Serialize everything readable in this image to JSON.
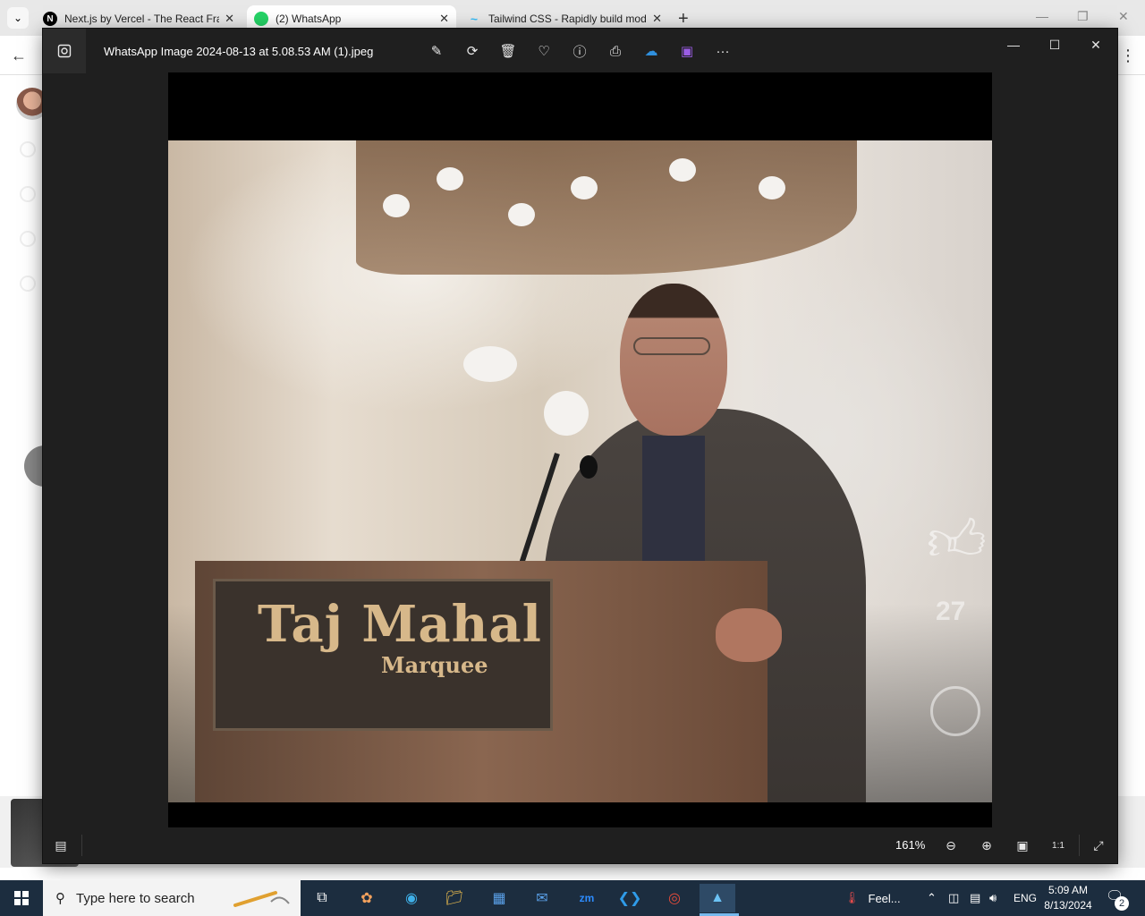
{
  "browser": {
    "tabs": [
      {
        "label": "Next.js by Vercel - The React Framework",
        "favicon": "N",
        "favicon_color": "#000000"
      },
      {
        "label": "(2) WhatsApp",
        "favicon": "",
        "favicon_color": "#25d366"
      },
      {
        "label": "Tailwind CSS - Rapidly build modern websites",
        "favicon": "~",
        "favicon_color": "#38bdf8"
      }
    ],
    "new_tab": "+"
  },
  "viewer": {
    "title": "WhatsApp Image 2024-08-13 at 5.08.53 AM (1).jpeg",
    "toolbar": [
      "edit-image-icon",
      "rotate-icon",
      "delete-icon",
      "favorite-icon",
      "info-icon",
      "print-icon",
      "onedrive-icon",
      "clipchamp-icon",
      "more-icon"
    ],
    "zoom": "161%",
    "photo": {
      "sign_text": "Taj Mahal",
      "sign_sub": "Marquee",
      "overlay_count": "27"
    }
  },
  "taskbar": {
    "search_placeholder": "Type here to search",
    "weather": "Feel...",
    "language": "ENG",
    "time": "5:09 AM",
    "date": "8/13/2024",
    "notification_count": "2"
  },
  "colors": {
    "viewer_bg": "#1f1f1f",
    "taskbar_bg": "#1c2d3f",
    "tab_bar_bg": "#e8e8e8"
  }
}
